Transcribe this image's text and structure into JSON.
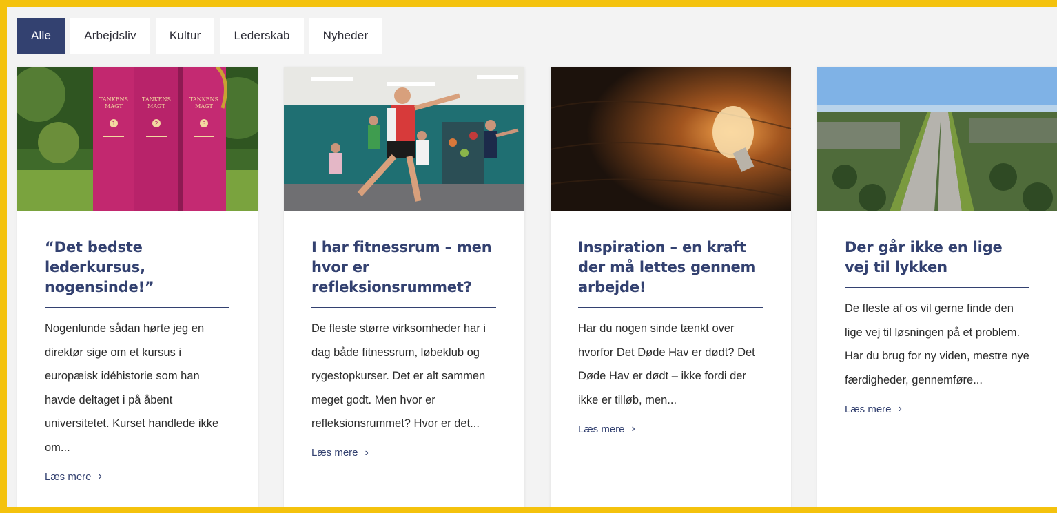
{
  "filters": [
    {
      "label": "Alle",
      "active": true
    },
    {
      "label": "Arbejdsliv",
      "active": false
    },
    {
      "label": "Kultur",
      "active": false
    },
    {
      "label": "Lederskab",
      "active": false
    },
    {
      "label": "Nyheder",
      "active": false
    }
  ],
  "cards": [
    {
      "title": "“Det bedste lederkursus, nogensinde!”",
      "text": "Nogenlunde sådan hørte jeg en direktør sige om et kursus i europæisk idéhistorie som han havde deltaget i på åbent universitetet. Kurset handlede ikke om...",
      "more": "Læs mere",
      "image": "book-spines-tankens-magt",
      "book_labels": {
        "brand": "TANKENS",
        "brand2": "MAGT",
        "vol": [
          "1",
          "2",
          "3"
        ]
      }
    },
    {
      "title": "I har fitnessrum – men hvor er refleksionsrummet?",
      "text": "De fleste større virksomheder har i dag både fitnessrum, løbeklub og rygestopkurser. Det er alt sammen meget godt. Men hvor er refleksionsrummet? Hvor er det...",
      "more": "Læs mere",
      "image": "fitness-class"
    },
    {
      "title": "Inspiration – en kraft der må lettes gennem arbejde!",
      "text": "Har du nogen sinde tænkt over hvorfor Det Døde Hav er dødt? Det Døde Hav er dødt – ikke fordi der ikke er tilløb, men...",
      "more": "Læs mere",
      "image": "light-bulb-on-wood"
    },
    {
      "title": "Der går ikke en lige vej til lykken",
      "text": "De fleste af os vil gerne finde den lige vej til løsningen på et problem. Har du brug for ny viden, mestre nye færdigheder, gennemføre...",
      "more": "Læs mere",
      "image": "aerial-highway"
    }
  ],
  "colors": {
    "accent": "#334170",
    "frame": "#f4c20d",
    "background": "#f3f3f3"
  }
}
